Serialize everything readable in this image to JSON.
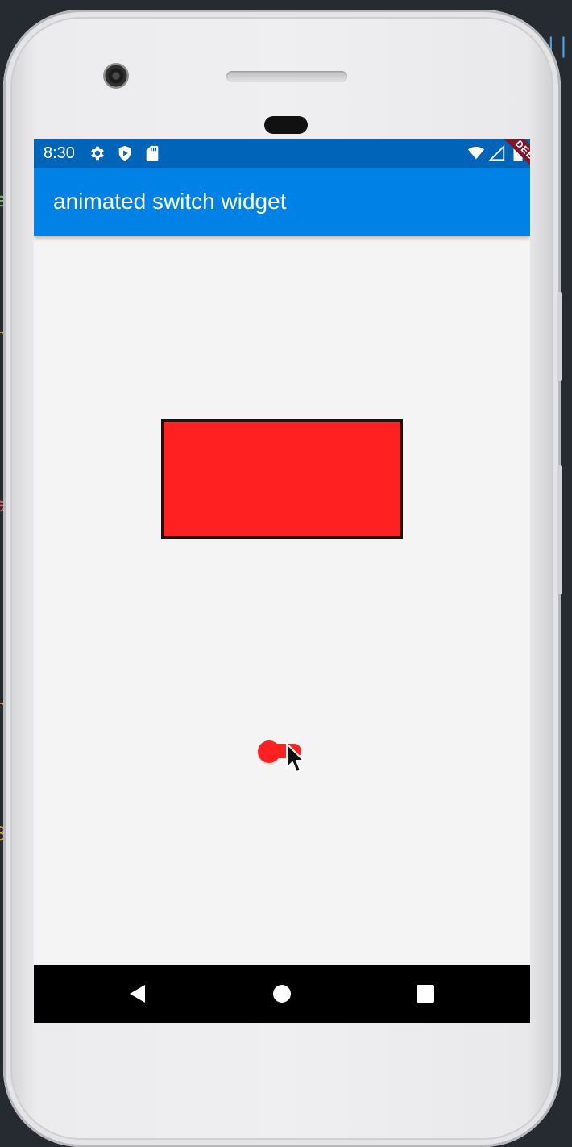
{
  "status_bar": {
    "time": "8:30",
    "left_icons": [
      "gear-icon",
      "shield-play-icon",
      "sd-card-icon"
    ],
    "right_icons": [
      "wifi-icon",
      "signal-icon",
      "battery-icon"
    ]
  },
  "app_bar": {
    "title": "animated switch widget"
  },
  "debug_banner": {
    "label": "DEBUG"
  },
  "content": {
    "box_color": "#ff2121",
    "switch": {
      "state": "on",
      "color": "#ff2121"
    }
  },
  "nav_bar": {
    "buttons": [
      "back-triangle-icon",
      "home-circle-icon",
      "recents-square-icon"
    ]
  },
  "colors": {
    "status_bar": "#0064b8",
    "app_bar": "#0081e6",
    "background": "#f4f4f4"
  }
}
